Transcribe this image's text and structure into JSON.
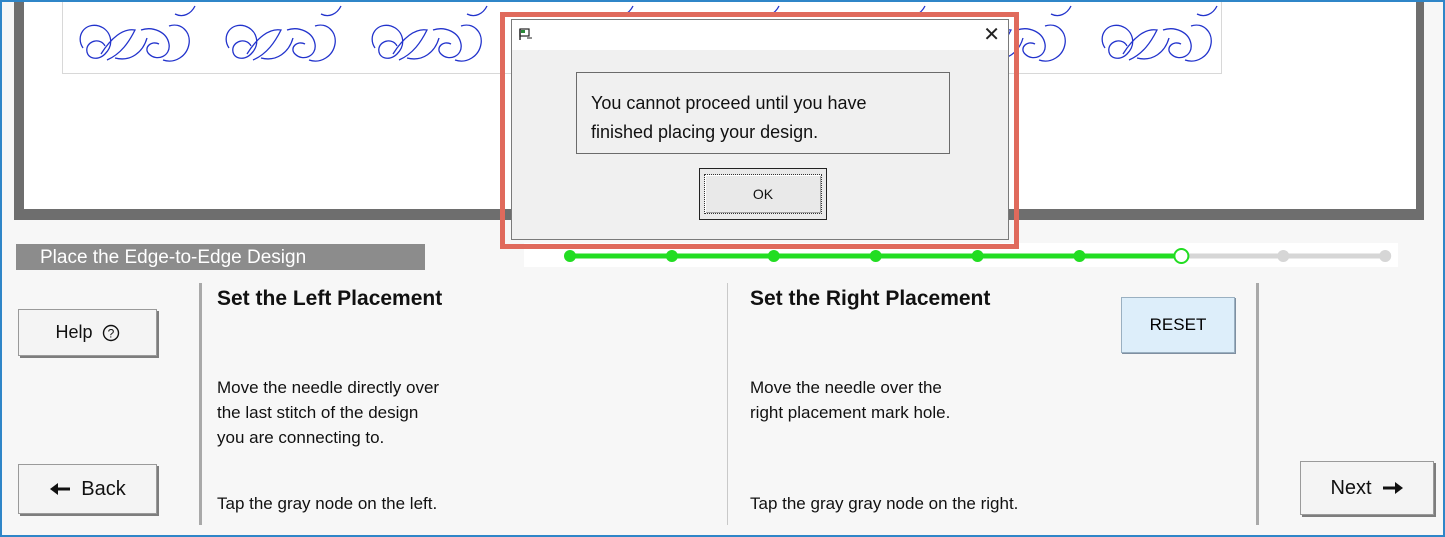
{
  "step": {
    "title": "Place the Edge-to-Edge Design"
  },
  "progress": {
    "total_nodes": 9,
    "completed_nodes": 6,
    "current_node": 7,
    "active_color": "#22dd22",
    "inactive_color": "#d6d6d6"
  },
  "buttons": {
    "help_label": "Help",
    "help_icon": "question-circle-icon",
    "back_label": "Back",
    "back_icon": "arrow-left-icon",
    "next_label": "Next",
    "next_icon": "arrow-right-icon",
    "reset_label": "RESET"
  },
  "left_section": {
    "heading": "Set the Left Placement",
    "instructions": [
      "Move the needle directly over",
      "the last stitch of the design",
      "you are connecting to."
    ],
    "tip": "Tap the gray node on the left."
  },
  "right_section": {
    "heading": "Set the Right Placement",
    "instructions": [
      "Move the needle over the",
      "right placement mark hole."
    ],
    "tip": "Tap the gray gray node on the right."
  },
  "dialog": {
    "message_line1": "You cannot proceed until you have",
    "message_line2": "finished placing your design.",
    "ok_label": "OK",
    "close_glyph": "✕",
    "highlight_color": "#e06a5c"
  },
  "colors": {
    "accent": "#2f86c8",
    "design_stroke": "#2233cc",
    "title_bg": "#8c8c8c"
  }
}
